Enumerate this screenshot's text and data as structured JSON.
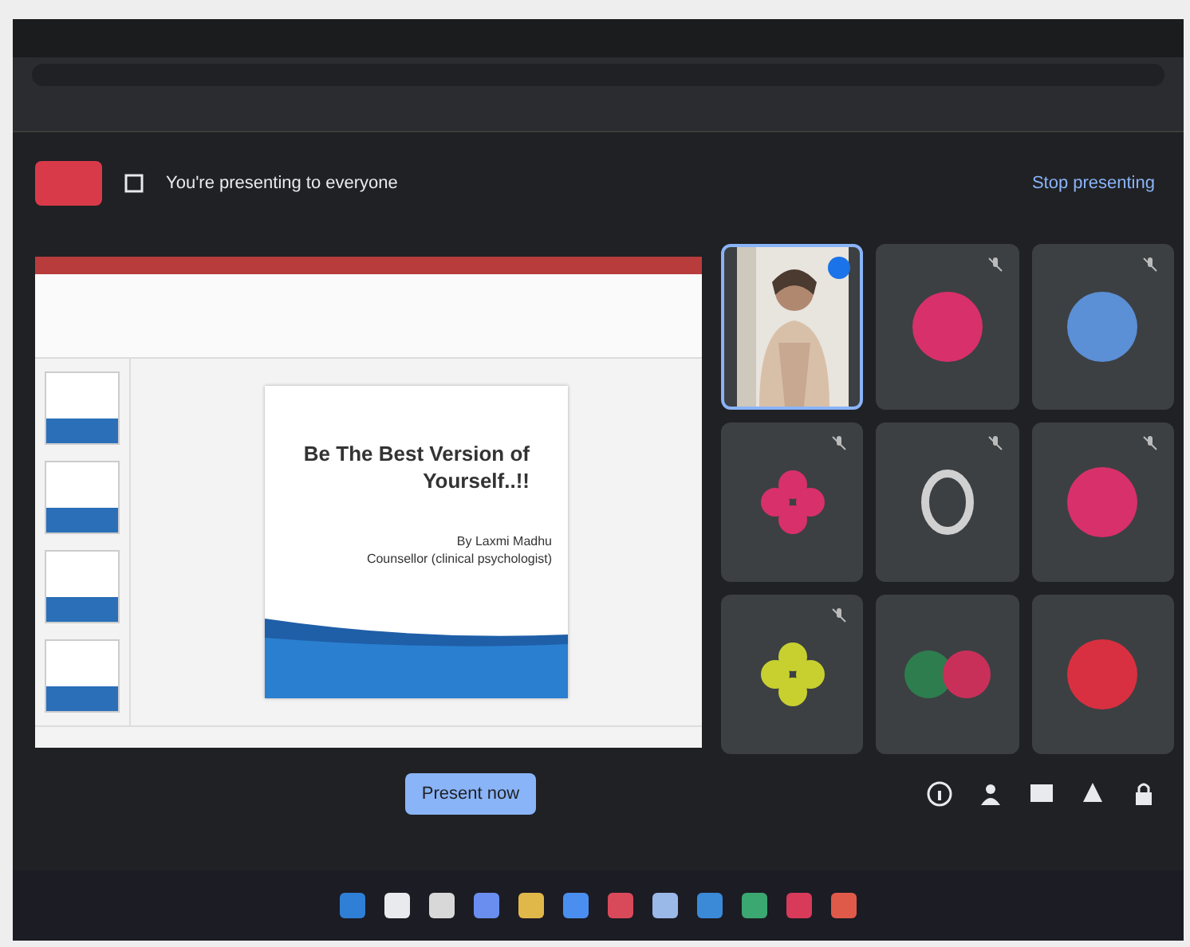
{
  "meet_banner": {
    "text": "You're presenting to everyone",
    "action": "Stop presenting"
  },
  "slide": {
    "title": [
      "Be The Best Version of",
      "Yourself..!!"
    ],
    "author": [
      "By Laxmi Madhu",
      "Counsellor (clinical psychologist)"
    ]
  },
  "participants": [
    {
      "kind": "video",
      "speaking": true,
      "muted": false
    },
    {
      "kind": "avatar",
      "color": "#d8306a",
      "speaking": false,
      "muted": true
    },
    {
      "kind": "avatar",
      "color": "#5b8fd6",
      "speaking": false,
      "muted": true
    },
    {
      "kind": "flower",
      "color": "#d8306a",
      "speaking": false,
      "muted": true
    },
    {
      "kind": "ring",
      "color": "#d0d0d0",
      "speaking": false,
      "muted": true
    },
    {
      "kind": "avatar",
      "color": "#d8306a",
      "speaking": false,
      "muted": true
    },
    {
      "kind": "flower",
      "color": "#c8d030",
      "speaking": false,
      "muted": true
    },
    {
      "kind": "pair",
      "color": "#c8305a",
      "speaking": false,
      "muted": false
    },
    {
      "kind": "avatar",
      "color": "#d83040",
      "speaking": false,
      "muted": false
    }
  ],
  "present_button": "Present now"
}
